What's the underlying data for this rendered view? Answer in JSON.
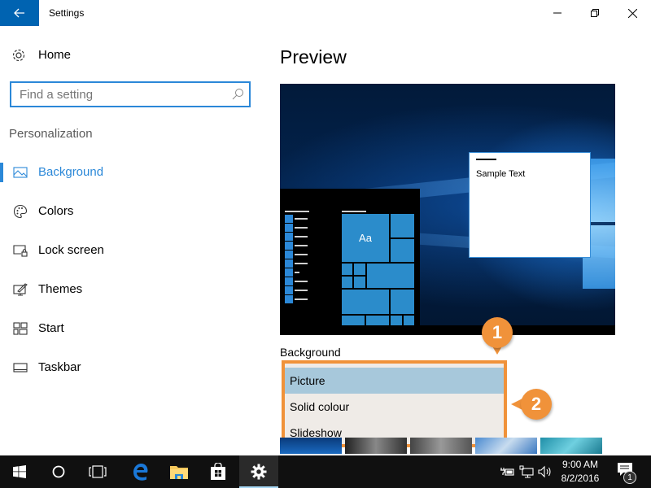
{
  "window": {
    "title": "Settings",
    "back_icon": "back-arrow-icon",
    "controls": {
      "minimize": "minimize-icon",
      "maximize": "restore-icon",
      "close": "close-icon"
    }
  },
  "sidebar": {
    "home": {
      "label": "Home",
      "icon": "gear-icon"
    },
    "search": {
      "placeholder": "Find a setting",
      "value": "",
      "icon": "search-icon"
    },
    "section_title": "Personalization",
    "items": [
      {
        "label": "Background",
        "icon": "picture-icon",
        "active": true
      },
      {
        "label": "Colors",
        "icon": "palette-icon",
        "active": false
      },
      {
        "label": "Lock screen",
        "icon": "lock-screen-icon",
        "active": false
      },
      {
        "label": "Themes",
        "icon": "themes-icon",
        "active": false
      },
      {
        "label": "Start",
        "icon": "start-tiles-icon",
        "active": false
      },
      {
        "label": "Taskbar",
        "icon": "taskbar-icon",
        "active": false
      }
    ]
  },
  "main": {
    "title": "Preview",
    "preview": {
      "sample_text": "Sample Text",
      "tile_label": "Aa"
    },
    "background_label": "Background",
    "dropdown": {
      "options": [
        "Picture",
        "Solid colour",
        "Slideshow"
      ],
      "selected": "Picture"
    }
  },
  "callouts": [
    "1",
    "2"
  ],
  "colors": {
    "accent": "#2b88d8",
    "back_button": "#0063b1",
    "callout": "#f0923a",
    "dropdown_selected": "#a7c8db",
    "dropdown_bg": "#efebe7",
    "taskbar": "#101010"
  },
  "taskbar": {
    "buttons": [
      {
        "name": "start",
        "icon": "windows-logo-icon"
      },
      {
        "name": "cortana",
        "icon": "cortana-circle-icon"
      },
      {
        "name": "task-view",
        "icon": "task-view-icon"
      },
      {
        "name": "edge",
        "icon": "edge-browser-icon"
      },
      {
        "name": "file-explorer",
        "icon": "folder-icon"
      },
      {
        "name": "store",
        "icon": "store-bag-icon"
      },
      {
        "name": "settings",
        "icon": "gear-icon",
        "active": true
      }
    ],
    "tray": [
      "power-plug-icon",
      "network-icon",
      "volume-icon"
    ],
    "time": "9:00 AM",
    "date": "8/2/2016",
    "notification_count": "1"
  }
}
